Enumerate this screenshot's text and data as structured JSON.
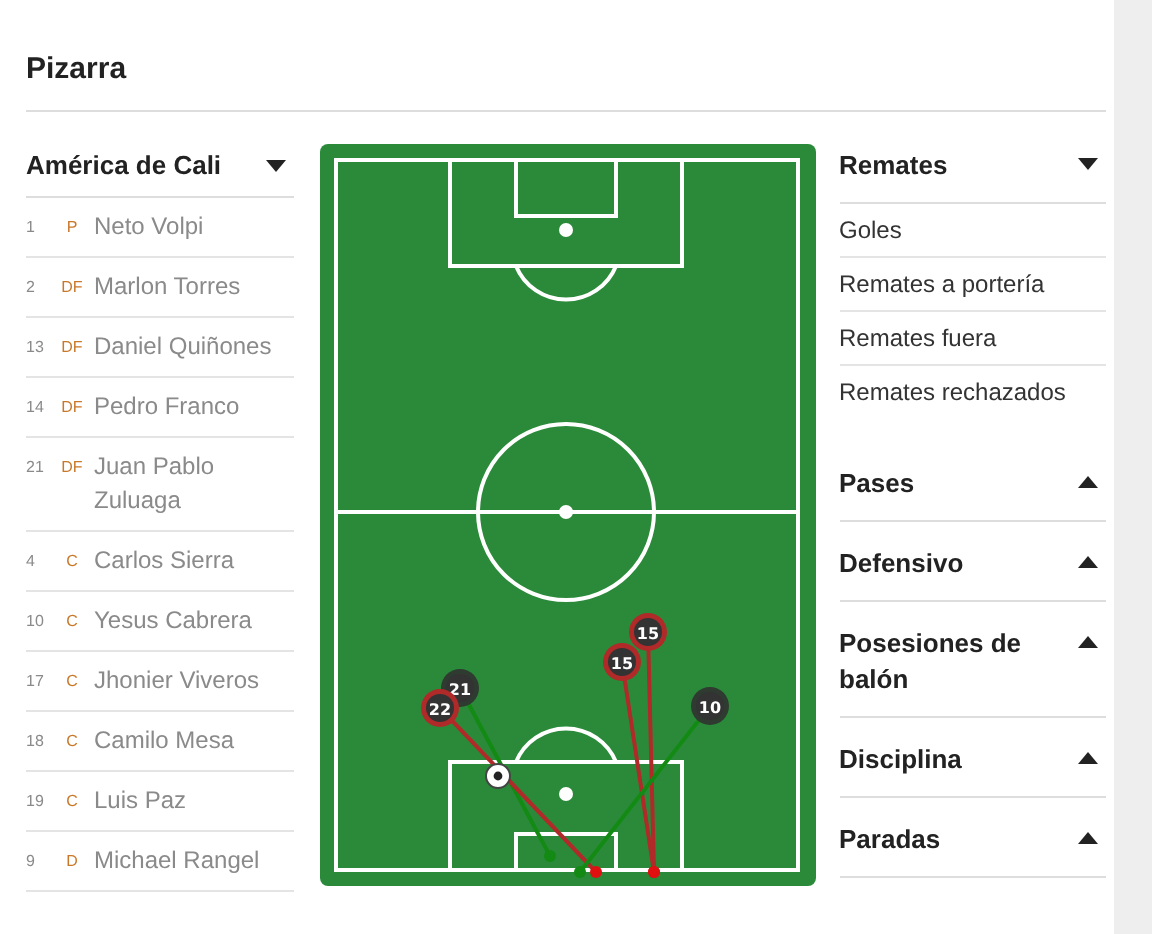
{
  "title": "Pizarra",
  "team": {
    "name": "América de Cali",
    "expanded": true
  },
  "players": [
    {
      "number": "1",
      "position": "P",
      "name": "Neto Volpi"
    },
    {
      "number": "2",
      "position": "DF",
      "name": "Marlon Torres"
    },
    {
      "number": "13",
      "position": "DF",
      "name": "Daniel Quiñones"
    },
    {
      "number": "14",
      "position": "DF",
      "name": "Pedro Franco"
    },
    {
      "number": "21",
      "position": "DF",
      "name": "Juan Pablo Zuluaga"
    },
    {
      "number": "4",
      "position": "C",
      "name": "Carlos Sierra"
    },
    {
      "number": "10",
      "position": "C",
      "name": "Yesus Cabrera"
    },
    {
      "number": "17",
      "position": "C",
      "name": "Jhonier Viveros"
    },
    {
      "number": "18",
      "position": "C",
      "name": "Camilo Mesa"
    },
    {
      "number": "19",
      "position": "C",
      "name": "Luis Paz"
    },
    {
      "number": "9",
      "position": "D",
      "name": "Michael Rangel"
    }
  ],
  "shots": [
    {
      "number": "21",
      "color": "#2f3a30"
    },
    {
      "number": "22",
      "color": "#b02a2a"
    },
    {
      "number": "15",
      "color": "#b02a2a"
    },
    {
      "number": "15",
      "color": "#b02a2a"
    },
    {
      "number": "10",
      "color": "#2f3a30"
    }
  ],
  "sections": [
    {
      "title": "Remates",
      "expanded": true,
      "items": [
        "Goles",
        "Remates a portería",
        "Remates fuera",
        "Remates rechazados"
      ]
    },
    {
      "title": "Pases",
      "expanded": false
    },
    {
      "title": "Defensivo",
      "expanded": false
    },
    {
      "title": "Posesiones de balón",
      "expanded": false
    },
    {
      "title": "Disciplina",
      "expanded": false
    },
    {
      "title": "Paradas",
      "expanded": false
    }
  ]
}
